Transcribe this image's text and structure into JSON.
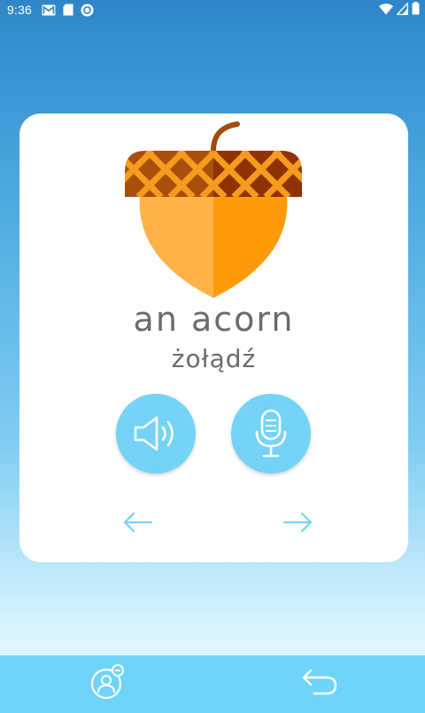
{
  "status_bar": {
    "time": "9:36",
    "icons": [
      "gmail-icon",
      "sd-card-icon",
      "sync-icon",
      "wifi-icon",
      "signal-icon",
      "battery-icon"
    ]
  },
  "flashcard": {
    "image": "acorn-illustration",
    "word_english": "an acorn",
    "word_translation": "żołądź"
  },
  "controls": {
    "play_audio": "speaker-icon",
    "record": "microphone-icon",
    "previous": "arrow-left-icon",
    "next": "arrow-right-icon"
  },
  "bottom_bar": {
    "left": "profile-icon",
    "right": "return-icon"
  },
  "colors": {
    "accent": "#74d3f7",
    "bottom_bar": "#70d4f9",
    "text": "#6b6b6b",
    "card": "#ffffff",
    "acorn_cap": "#a34800",
    "acorn_body": "#ff9b0a"
  }
}
